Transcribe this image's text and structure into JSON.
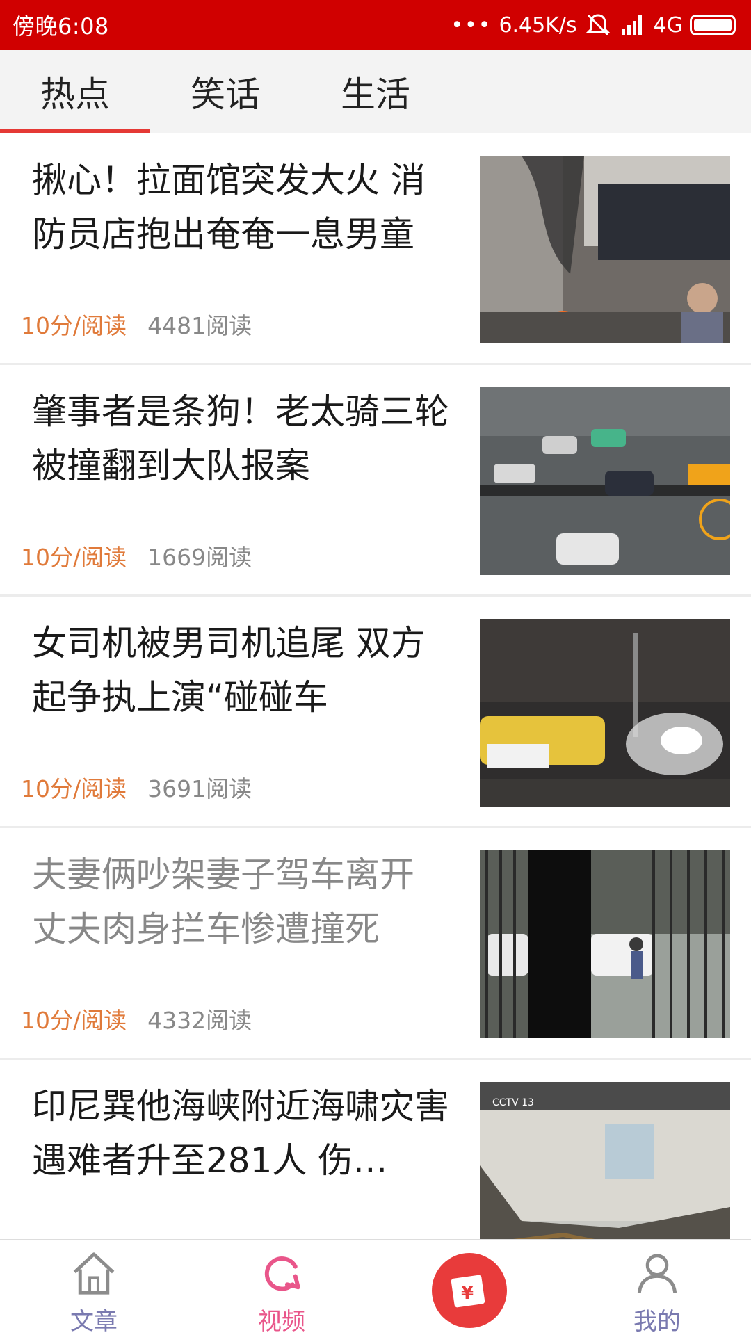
{
  "status_bar": {
    "time": "傍晚6:08",
    "network_speed": "6.45K/s",
    "network_type": "4G",
    "icons": [
      "more-dots-icon",
      "mute-icon",
      "signal-icon",
      "battery-icon"
    ]
  },
  "tabs": [
    {
      "label": "热点",
      "active": true
    },
    {
      "label": "笑话",
      "active": false
    },
    {
      "label": "生活",
      "active": false
    }
  ],
  "articles": [
    {
      "title": "揪心！拉面馆突发大火 消防员店抱出奄奄一息男童",
      "read_time": "10分/阅读",
      "reads": "4481阅读",
      "visited": false,
      "thumbnail": "fire-shop-photo"
    },
    {
      "title": "肇事者是条狗！老太骑三轮被撞翻到大队报案",
      "read_time": "10分/阅读",
      "reads": "1669阅读",
      "visited": false,
      "thumbnail": "traffic-camera-photo"
    },
    {
      "title": "女司机被男司机追尾 双方起争执上演“碰碰车",
      "read_time": "10分/阅读",
      "reads": "3691阅读",
      "visited": false,
      "thumbnail": "night-car-photo"
    },
    {
      "title": "夫妻俩吵架妻子驾车离开 丈夫肉身拦车惨遭撞死",
      "read_time": "10分/阅读",
      "reads": "4332阅读",
      "visited": true,
      "thumbnail": "gate-street-photo"
    },
    {
      "title": "印尼巽他海峡附近海啸灾害 遇难者升至281人 伤…",
      "read_time": "",
      "reads": "",
      "visited": false,
      "thumbnail": "damaged-house-photo",
      "thumb_text": "CCTV 13"
    }
  ],
  "bottom_nav": [
    {
      "label": "文章",
      "icon": "home-icon",
      "active": false
    },
    {
      "label": "视频",
      "icon": "refresh-video-icon",
      "active": true
    },
    {
      "label": "",
      "icon": "red-envelope-icon",
      "active": false
    },
    {
      "label": "我的",
      "icon": "user-icon",
      "active": false
    }
  ],
  "colors": {
    "status_bar": "#d00000",
    "tab_indicator": "#e53935",
    "read_time": "#e07a3a",
    "nav_active": "#e9568a",
    "nav_inactive": "#7a7ab0",
    "center_button": "#e83b3b"
  }
}
